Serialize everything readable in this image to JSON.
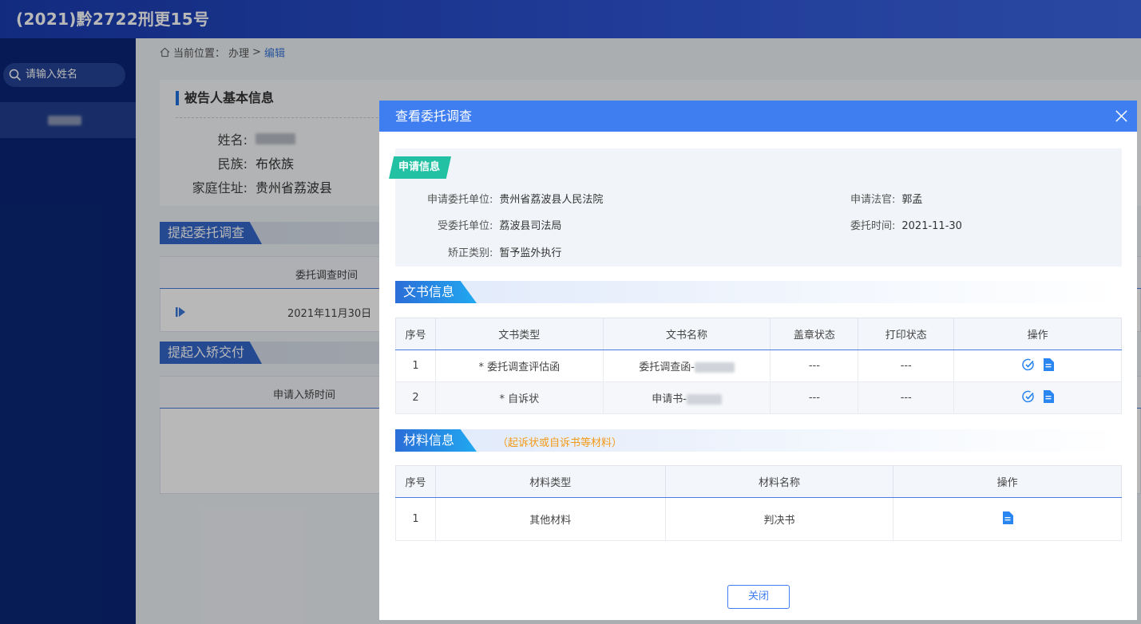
{
  "header": {
    "title": "(2021)黔2722刑更15号"
  },
  "sidebar": {
    "search_placeholder": "请输入姓名"
  },
  "breadcrumb": {
    "prefix": "当前位置：",
    "item1": "办理",
    "sep": ">",
    "current": "编辑"
  },
  "basic_info": {
    "title": "被告人基本信息",
    "name_label": "姓名:",
    "ethnicity_label": "民族:",
    "ethnicity": "布依族",
    "address_label": "家庭住址:",
    "address": "贵州省荔波县"
  },
  "background": {
    "tab1": "提起委托调查",
    "col1": "委托调查时间",
    "row1_date": "2021年11月30日",
    "tab2": "提起入矫交付",
    "col2": "申请入矫时间"
  },
  "dialog": {
    "title": "查看委托调查",
    "apply": {
      "badge": "申请信息",
      "unit_label": "申请委托单位:",
      "unit": "贵州省荔波县人民法院",
      "judge_label": "申请法官:",
      "judge": "郭孟",
      "entrusted_label": "受委托单位:",
      "entrusted": "荔波县司法局",
      "time_label": "委托时间:",
      "time": "2021-11-30",
      "category_label": "矫正类别:",
      "category": "暂予监外执行"
    },
    "docs": {
      "tab": "文书信息",
      "headers": [
        "序号",
        "文书类型",
        "文书名称",
        "盖章状态",
        "打印状态",
        "操作"
      ],
      "rows": [
        {
          "no": "1",
          "type": "* 委托调查评估函",
          "name": "委托调查函-",
          "seal": "---",
          "print": "---"
        },
        {
          "no": "2",
          "type": "* 自诉状",
          "name": "申请书-",
          "seal": "---",
          "print": "---"
        }
      ]
    },
    "materials": {
      "tab": "材料信息",
      "note": "（起诉状或自诉书等材料）",
      "headers": [
        "序号",
        "材料类型",
        "材料名称",
        "操作"
      ],
      "rows": [
        {
          "no": "1",
          "type": "其他材料",
          "name": "判决书"
        }
      ]
    },
    "close_label": "关闭"
  },
  "icons": {
    "search": "search-icon",
    "home": "home-icon",
    "close": "close-icon",
    "check": "check-circle-icon",
    "doc": "document-icon",
    "play": "play-icon"
  },
  "colors": {
    "primary": "#3f7ef0",
    "header": "#1a3cb0",
    "sidebar": "#0a2576",
    "badge": "#22c1a4",
    "note": "#f39a1a"
  }
}
